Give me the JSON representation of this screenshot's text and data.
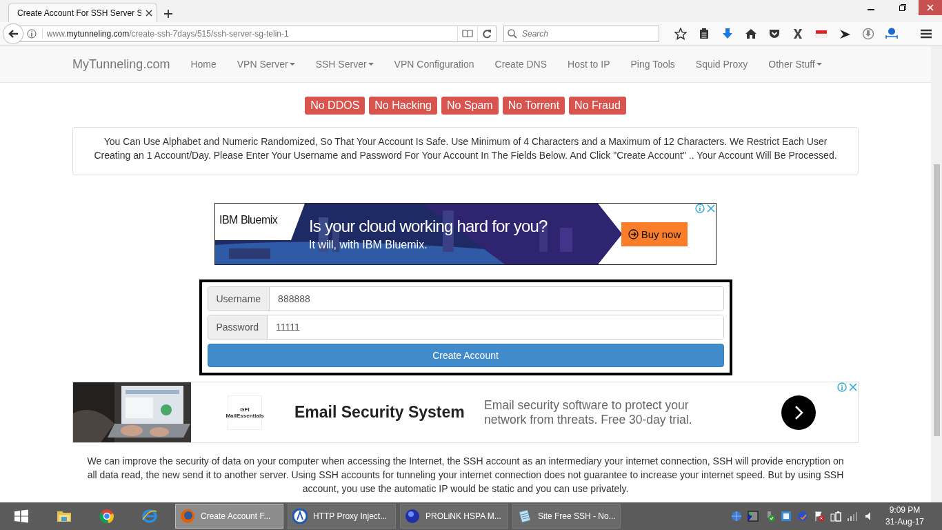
{
  "browser": {
    "tab_title": "Create Account For SSH Server S",
    "url": {
      "prefix": "www.",
      "domain": "mytunneling.com",
      "path": "/create-ssh-7days/515/ssh-server-sg-telin-1"
    },
    "search_placeholder": "Search"
  },
  "site_nav": {
    "brand": "MyTunneling.com",
    "items": [
      {
        "label": "Home",
        "dropdown": false
      },
      {
        "label": "VPN Server",
        "dropdown": true
      },
      {
        "label": "SSH Server",
        "dropdown": true
      },
      {
        "label": "VPN Configuration",
        "dropdown": false
      },
      {
        "label": "Create DNS",
        "dropdown": false
      },
      {
        "label": "Host to IP",
        "dropdown": false
      },
      {
        "label": "Ping Tools",
        "dropdown": false
      },
      {
        "label": "Squid Proxy",
        "dropdown": false
      },
      {
        "label": "Other Stuff",
        "dropdown": true
      }
    ]
  },
  "rules": [
    "No DDOS",
    "No Hacking",
    "No Spam",
    "No Torrent",
    "No Fraud"
  ],
  "notice": "You Can Use Alphabet and Numeric Randomized, So That Your Account Is Safe. Use Minimum of 4 Characters and a Maximum of 12 Characters. We Restrict Each User Creating an 1 Account/Day. Please Enter Your Username and Password For Your Account In The Fields Below. And Click \"Create Account\" .. Your Account Will Be Processed.",
  "ad_top": {
    "brand": "IBM Bluemix",
    "headline": "Is your cloud working hard for you?",
    "subline": "It will, with IBM Bluemix.",
    "button": "Buy now"
  },
  "form": {
    "fields": [
      {
        "label": "Username",
        "value": "888888"
      },
      {
        "label": "Password",
        "value": "11111"
      }
    ],
    "submit": "Create Account"
  },
  "ad_bottom": {
    "logo": "GFI MailEssentials",
    "headline": "Email Security System",
    "text": "Email security software to protect your network from threats. Free 30-day trial."
  },
  "about": "We can improve the security of data on your computer when accessing the Internet, the SSH account as an intermediary your internet connection, SSH will provide encryption on all data read, the new send it to another server. Using SSH accounts for tunneling your internet connection does not guarantee to increase your internet speed. But by using SSH account, you use the automatic IP would be static and you can use privately.",
  "taskbar": {
    "windows": [
      {
        "label": "Create Account F...",
        "selected": true,
        "kind": "firefox"
      },
      {
        "label": "HTTP Proxy Inject...",
        "selected": false,
        "kind": "proxy"
      },
      {
        "label": "PROLiNK HSPA M...",
        "selected": false,
        "kind": "modem"
      },
      {
        "label": "Site Free SSH - No...",
        "selected": false,
        "kind": "notepad"
      }
    ],
    "time": "9:09 PM",
    "date": "31-Aug-17"
  }
}
